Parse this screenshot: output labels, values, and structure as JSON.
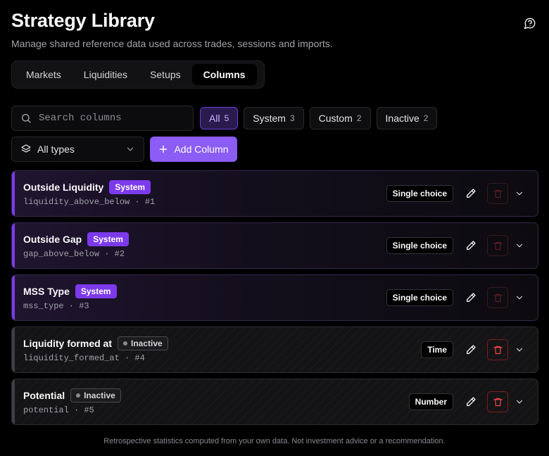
{
  "header": {
    "title": "Strategy Library",
    "subtitle": "Manage shared reference data used across trades, sessions and imports.",
    "help_icon": "help-chat-icon"
  },
  "tabs": [
    {
      "label": "Markets",
      "active": false
    },
    {
      "label": "Liquidities",
      "active": false
    },
    {
      "label": "Setups",
      "active": false
    },
    {
      "label": "Columns",
      "active": true
    }
  ],
  "search": {
    "placeholder": "Search columns",
    "value": "",
    "icon": "search-icon"
  },
  "filters": [
    {
      "label": "All",
      "count": "5",
      "active": true
    },
    {
      "label": "System",
      "count": "3",
      "active": false
    },
    {
      "label": "Custom",
      "count": "2",
      "active": false
    },
    {
      "label": "Inactive",
      "count": "2",
      "active": false
    }
  ],
  "type_select": {
    "value": "All types",
    "icon": "layers-icon"
  },
  "add_button": {
    "label": "Add Column",
    "icon": "plus-icon"
  },
  "columns": [
    {
      "name": "Outside Liquidity",
      "badge": "System",
      "status": "system",
      "key": "liquidity_above_below · #1",
      "type": "Single choice",
      "delete_enabled": false
    },
    {
      "name": "Outside Gap",
      "badge": "System",
      "status": "system",
      "key": "gap_above_below · #2",
      "type": "Single choice",
      "delete_enabled": false
    },
    {
      "name": "MSS Type",
      "badge": "System",
      "status": "system",
      "key": "mss_type · #3",
      "type": "Single choice",
      "delete_enabled": false
    },
    {
      "name": "Liquidity formed at",
      "badge": "Inactive",
      "status": "inactive",
      "key": "liquidity_formed_at · #4",
      "type": "Time",
      "delete_enabled": true
    },
    {
      "name": "Potential",
      "badge": "Inactive",
      "status": "inactive",
      "key": "potential · #5",
      "type": "Number",
      "delete_enabled": true
    }
  ],
  "footer": {
    "text": "Retrospective statistics computed from your own data. Not investment advice or a recommendation."
  },
  "colors": {
    "accent": "#8b5cf6",
    "system_badge": "#7c3aed",
    "delete": "#dc2626",
    "background": "#000000"
  }
}
